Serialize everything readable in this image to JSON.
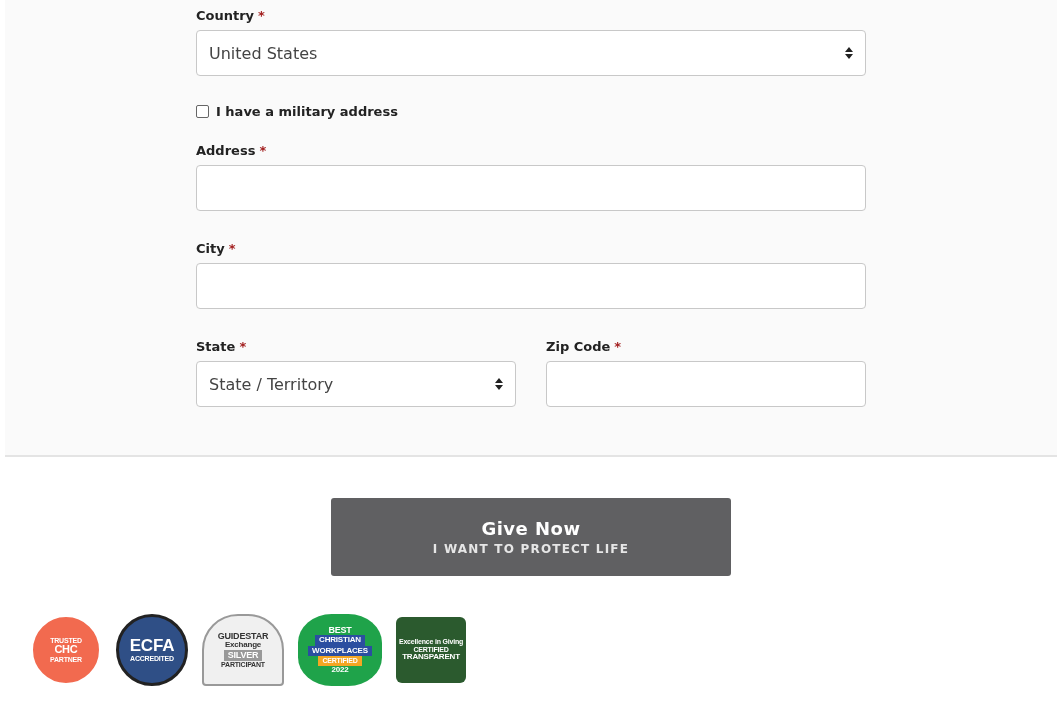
{
  "form": {
    "rows": [
      [
        {
          "kind": "select",
          "label": "Country",
          "required_mark": "*",
          "value": "United States"
        }
      ],
      [
        {
          "kind": "checkbox",
          "label": "I have a military address",
          "checked": false
        }
      ],
      [
        {
          "kind": "text",
          "label": "Address",
          "required_mark": "*"
        }
      ],
      [
        {
          "kind": "text",
          "label": "City",
          "required_mark": "*"
        }
      ],
      [
        {
          "kind": "select",
          "label": "State",
          "required_mark": "*",
          "value": "State / Territory"
        },
        {
          "kind": "text",
          "label": "Zip Code",
          "required_mark": "*"
        }
      ]
    ]
  },
  "submit": {
    "title": "Give Now",
    "subtitle": "I WANT TO PROTECT LIFE"
  },
  "badges": [
    {
      "kind": "chc",
      "lines": [
        "TRUSTED",
        "CHC",
        "PARTNER"
      ]
    },
    {
      "kind": "ecfa",
      "lines": [
        "ECFA",
        "ACCREDITED"
      ]
    },
    {
      "kind": "guidestar",
      "lines": [
        "GUIDESTAR",
        "Exchange",
        "SILVER",
        "PARTICIPANT"
      ]
    },
    {
      "kind": "bcw",
      "lines": [
        "BEST",
        "CHRISTIAN",
        "WORKPLACES",
        "CERTIFIED",
        "2022"
      ]
    },
    {
      "kind": "eig",
      "lines": [
        "Excellence in Giving",
        "CERTIFIED",
        "TRANSPARENT"
      ]
    }
  ]
}
